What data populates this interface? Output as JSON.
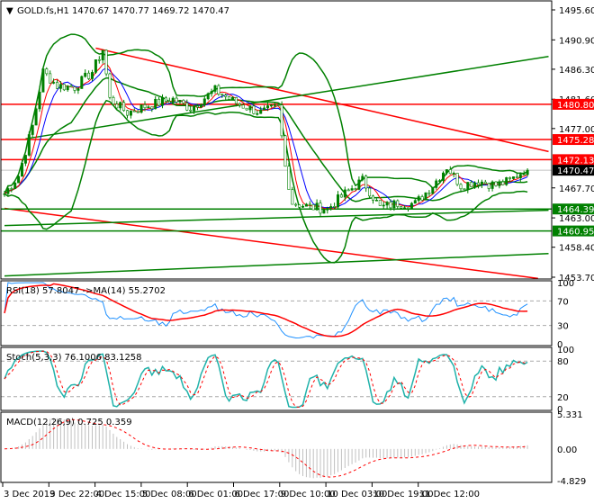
{
  "chart_data": {
    "type": "line",
    "title": "GOLD.fs,H1",
    "ohlc_label": "1470.67 1470.77 1469.72 1470.47",
    "header": "GOLD.fs,H1  1470.67 1470.77 1469.72 1470.47",
    "ylim": [
      1453.7,
      1495.6
    ],
    "price_ticks": [
      "1495.60",
      "1490.90",
      "1486.30",
      "1481.60",
      "1477.00",
      "1467.70",
      "1463.00",
      "1458.40",
      "1453.70"
    ],
    "price_tags": [
      {
        "label": "1480.80",
        "value": 1480.8,
        "color": "#ff0000"
      },
      {
        "label": "1475.28",
        "value": 1475.28,
        "color": "#ff0000"
      },
      {
        "label": "1472.13",
        "value": 1472.13,
        "color": "#ff0000"
      },
      {
        "label": "1470.47",
        "value": 1470.47,
        "color": "#000000"
      },
      {
        "label": "1464.39",
        "value": 1464.39,
        "color": "#008000"
      },
      {
        "label": "1460.95",
        "value": 1460.95,
        "color": "#008000"
      }
    ],
    "time_labels": [
      "3 Dec 2019",
      "3 Dec 22:00",
      "4 Dec 15:00",
      "5 Dec 08:00",
      "6 Dec 01:00",
      "6 Dec 17:00",
      "9 Dec 10:00",
      "10 Dec 03:00",
      "10 Dec 19:00",
      "11 Dec 12:00"
    ],
    "close_keypoints": [
      [
        0,
        1466.8
      ],
      [
        4,
        1469.6
      ],
      [
        8,
        1477.4
      ],
      [
        11,
        1485.9
      ],
      [
        15,
        1483.7
      ],
      [
        20,
        1483.5
      ],
      [
        25,
        1485.9
      ],
      [
        28,
        1489.4
      ],
      [
        30,
        1481.6
      ],
      [
        35,
        1479.5
      ],
      [
        40,
        1480.5
      ],
      [
        48,
        1481.6
      ],
      [
        53,
        1480.2
      ],
      [
        60,
        1483.0
      ],
      [
        66,
        1481.0
      ],
      [
        73,
        1479.5
      ],
      [
        78,
        1480.3
      ],
      [
        80,
        1471.0
      ],
      [
        82,
        1465.4
      ],
      [
        87,
        1464.7
      ],
      [
        92,
        1464.4
      ],
      [
        97,
        1466.8
      ],
      [
        102,
        1468.9
      ],
      [
        107,
        1464.6
      ],
      [
        112,
        1465.3
      ],
      [
        117,
        1465.2
      ],
      [
        122,
        1468.1
      ],
      [
        126,
        1471.0
      ],
      [
        130,
        1468.1
      ],
      [
        135,
        1468.8
      ],
      [
        140,
        1468.1
      ],
      [
        144,
        1468.8
      ],
      [
        148,
        1470.47
      ]
    ],
    "trendlines": [
      {
        "color": "#ff0000",
        "from": [
          26,
          1489.6
        ],
        "to": [
          155,
          1473.4
        ]
      },
      {
        "color": "#ff0000",
        "from": [
          0,
          1464.5
        ],
        "to": [
          152,
          1453.5
        ]
      },
      {
        "color": "#008000",
        "from": [
          6,
          1475.4
        ],
        "to": [
          155,
          1488.3
        ]
      },
      {
        "color": "#008000",
        "from": [
          0,
          1461.8
        ],
        "to": [
          155,
          1464.2
        ]
      },
      {
        "color": "#008000",
        "from": [
          0,
          1453.9
        ],
        "to": [
          155,
          1457.4
        ]
      }
    ],
    "rsi": {
      "label": "RSI(18) 57.8047  ->MA(14) 55.2702",
      "levels": [
        "100",
        "70",
        "30",
        "0"
      ]
    },
    "stoch": {
      "label": "Stoch(5,3,3) 76.1006 83.1258",
      "levels": [
        "100",
        "80",
        "20",
        "0"
      ]
    },
    "macd": {
      "label": "MACD(12,26,9) 0.725 0.359",
      "levels": [
        "5.331",
        "0.00",
        "-4.829"
      ]
    }
  }
}
